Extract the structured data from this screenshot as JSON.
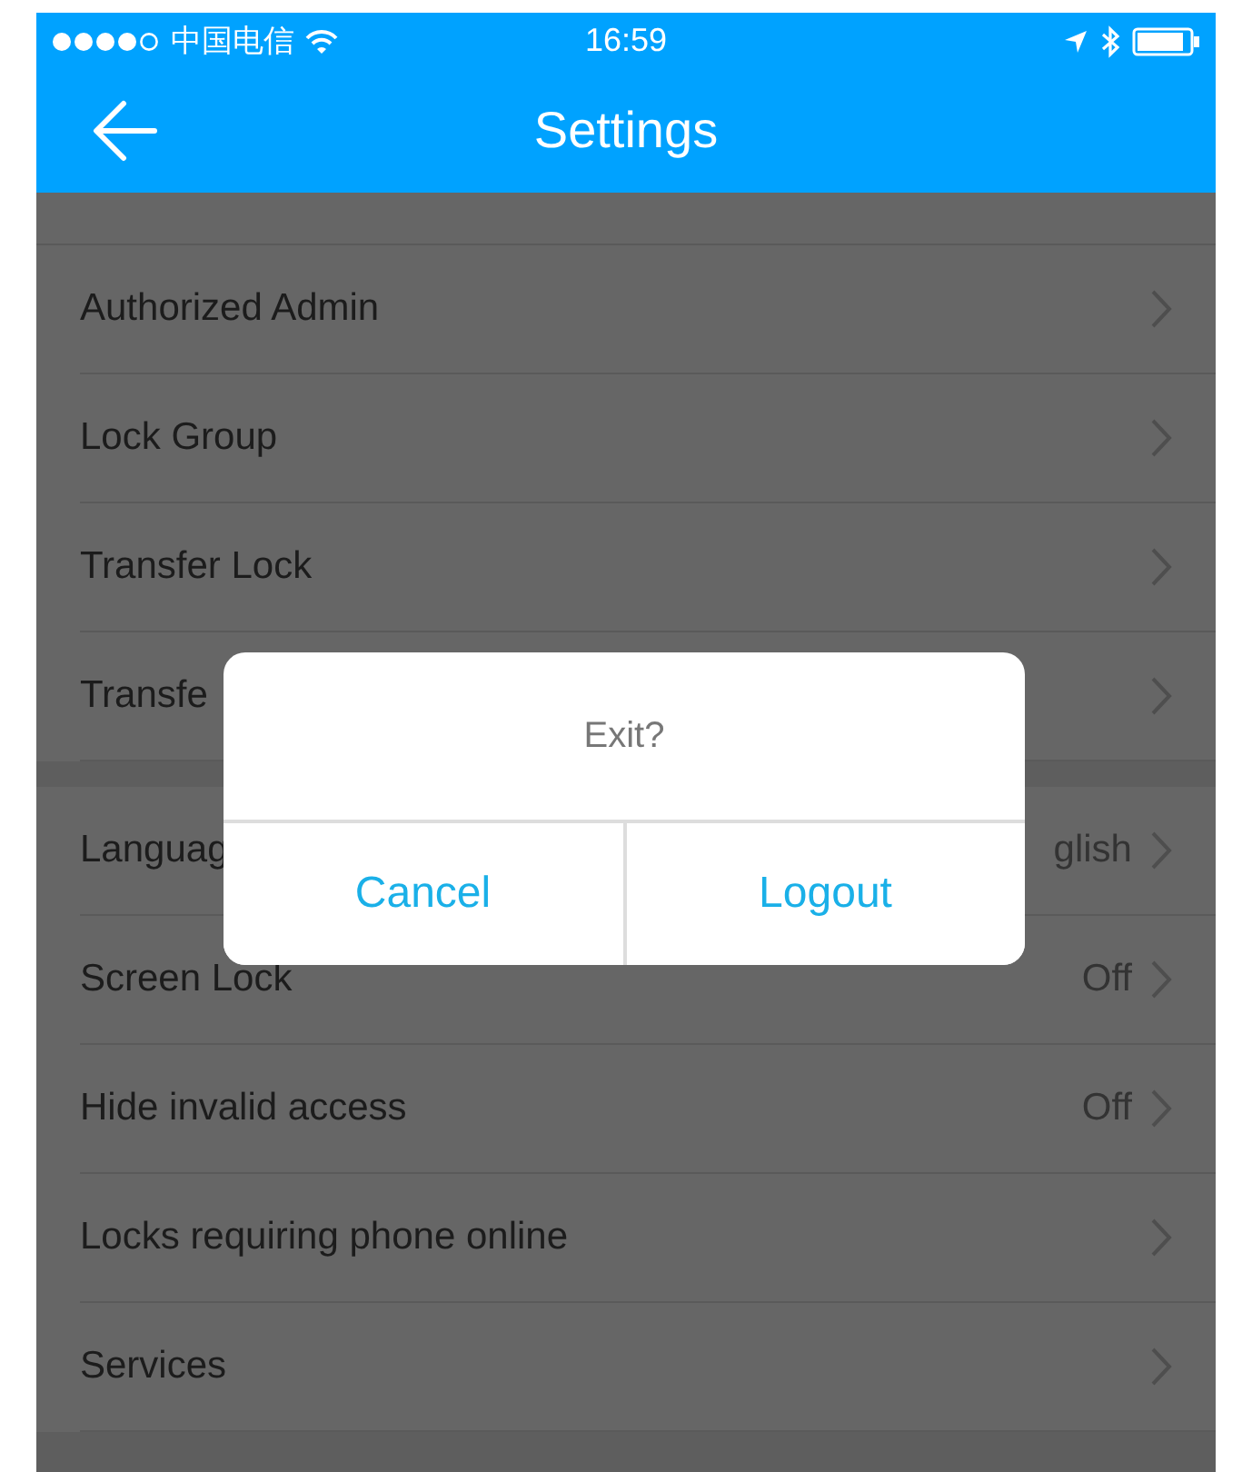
{
  "status_bar": {
    "carrier": "中国电信",
    "time": "16:59"
  },
  "nav": {
    "title": "Settings"
  },
  "sections": [
    {
      "rows": [
        {
          "label": "Authorized Admin"
        },
        {
          "label": "Lock Group"
        },
        {
          "label": "Transfer Lock"
        },
        {
          "label": "Transfe"
        }
      ]
    },
    {
      "rows": [
        {
          "label": "Languag",
          "value": "glish"
        },
        {
          "label": "Screen Lock",
          "value": "Off"
        },
        {
          "label": "Hide invalid access",
          "value": "Off"
        },
        {
          "label": "Locks requiring phone online"
        },
        {
          "label": "Services"
        }
      ]
    }
  ],
  "dialog": {
    "message": "Exit?",
    "buttons": [
      "Cancel",
      "Logout"
    ]
  }
}
